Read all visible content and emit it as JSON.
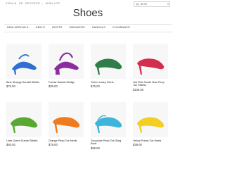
{
  "topbar": {
    "links": [
      "SIGN IN",
      "OR",
      "REGISTER",
      "|",
      "WISH LIST"
    ],
    "cart_amount": "$0.00"
  },
  "title": "Shoes",
  "nav": [
    "NEW ARRIVALS",
    "HEELS",
    "BOOTS",
    "SNEAKERS",
    "SANDALS",
    "CLEARANCE"
  ],
  "products": [
    {
      "name": "Blue Strappy Sandal Stiletto",
      "price": "$75.00",
      "color": "#2f6fd1"
    },
    {
      "name": "Fuchia Sandal Wedge",
      "price": "$39.00",
      "color": "#8a2e9e"
    },
    {
      "name": "Green Lacey Heels",
      "price": "$75.00",
      "color": "#2e7d4a"
    },
    {
      "name": "Hot Pink Suede Bow Peep Toe Stiletto",
      "price": "$105.00",
      "color": "#d42e4f"
    },
    {
      "name": "Lime Green Suede Stiletto",
      "price": "$40.00",
      "color": "#5aa832"
    },
    {
      "name": "Orange Peep Toe Heels",
      "price": "$75.00",
      "color": "#f07a1e"
    },
    {
      "name": "Turquoise Peep Toe Sling Back",
      "price": "$55.00",
      "color": "#3db4d9"
    },
    {
      "name": "Yellow Pointy Toe Heels",
      "price": "$39.00",
      "color": "#f2cf22"
    }
  ]
}
